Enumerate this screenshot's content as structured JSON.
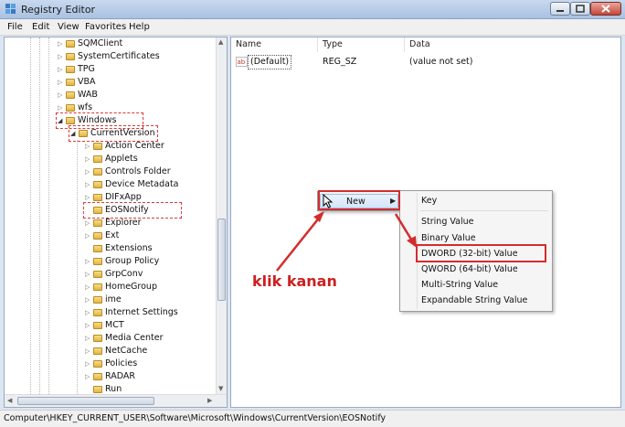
{
  "window": {
    "title": "Registry Editor"
  },
  "menu": [
    "File",
    "Edit",
    "View",
    "Favorites",
    "Help"
  ],
  "tree": {
    "items": [
      {
        "label": "SQMClient"
      },
      {
        "label": "SystemCertificates"
      },
      {
        "label": "TPG"
      },
      {
        "label": "VBA"
      },
      {
        "label": "WAB"
      },
      {
        "label": "wfs"
      },
      {
        "label": "Windows"
      },
      {
        "label": "CurrentVersion"
      },
      {
        "label": "Action Center"
      },
      {
        "label": "Applets"
      },
      {
        "label": "Controls Folder"
      },
      {
        "label": "Device Metadata"
      },
      {
        "label": "DIFxApp"
      },
      {
        "label": "EOSNotify"
      },
      {
        "label": "Explorer"
      },
      {
        "label": "Ext"
      },
      {
        "label": "Extensions"
      },
      {
        "label": "Group Policy"
      },
      {
        "label": "GrpConv"
      },
      {
        "label": "HomeGroup"
      },
      {
        "label": "ime"
      },
      {
        "label": "Internet Settings"
      },
      {
        "label": "MCT"
      },
      {
        "label": "Media Center"
      },
      {
        "label": "NetCache"
      },
      {
        "label": "Policies"
      },
      {
        "label": "RADAR"
      },
      {
        "label": "Run"
      }
    ]
  },
  "list": {
    "columns": [
      "Name",
      "Type",
      "Data"
    ],
    "rows": [
      {
        "name": "(Default)",
        "type": "REG_SZ",
        "data": "(value not set)"
      }
    ]
  },
  "context_menu": {
    "new_label": "New",
    "submenu": [
      "Key",
      "String Value",
      "Binary Value",
      "DWORD (32-bit) Value",
      "QWORD (64-bit) Value",
      "Multi-String Value",
      "Expandable String Value"
    ]
  },
  "annotation": {
    "text": "klik kanan",
    "color": "#cc1f1f"
  },
  "status": {
    "path": "Computer\\HKEY_CURRENT_USER\\Software\\Microsoft\\Windows\\CurrentVersion\\EOSNotify"
  },
  "icons": {
    "value": "ab-string-icon",
    "folder": "folder-icon"
  }
}
